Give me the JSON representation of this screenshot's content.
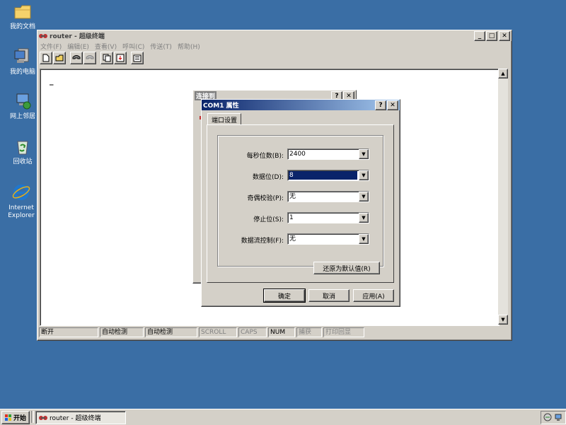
{
  "desktop": {
    "icons": [
      {
        "label": "我的文档"
      },
      {
        "label": "我的电脑"
      },
      {
        "label": "网上邻居"
      },
      {
        "label": "回收站"
      },
      {
        "label_line1": "Internet",
        "label_line2": "Explorer"
      }
    ]
  },
  "main_window": {
    "title": "router - 超级终端",
    "menu": [
      "文件(F)",
      "编辑(E)",
      "查看(V)",
      "呼叫(C)",
      "传送(T)",
      "帮助(H)"
    ],
    "cursor": "_",
    "status": [
      "断开",
      "自动检测",
      "自动检测",
      "SCROLL",
      "CAPS",
      "NUM",
      "捕获",
      "打印回显"
    ]
  },
  "connect_dialog": {
    "title": "连接到"
  },
  "com_dialog": {
    "title": "COM1 属性",
    "tab": "端口设置",
    "fields": [
      {
        "label": "每秒位数(B):",
        "value": "2400"
      },
      {
        "label": "数据位(D):",
        "value": "8"
      },
      {
        "label": "奇偶校验(P):",
        "value": "无"
      },
      {
        "label": "停止位(S):",
        "value": "1"
      },
      {
        "label": "数据流控制(F):",
        "value": "无"
      }
    ],
    "restore_button": "还原为默认值(R)",
    "ok_button": "确定",
    "cancel_button": "取消",
    "apply_button": "应用(A)"
  },
  "taskbar": {
    "start": "开始",
    "task": "router - 超级终端"
  },
  "colors": {
    "desktop": "#3a6ea5",
    "active_title": "#0a246a",
    "face": "#d4d0c8"
  }
}
